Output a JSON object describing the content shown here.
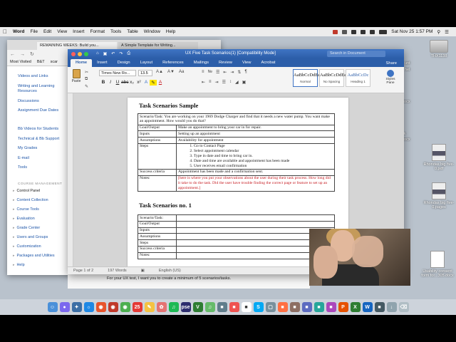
{
  "menubar": {
    "app": "Word",
    "items": [
      "File",
      "Edit",
      "View",
      "Insert",
      "Format",
      "Tools",
      "Table",
      "Window",
      "Help"
    ],
    "clock": "Sat Nov 25  1:57 PM"
  },
  "desktop": {
    "items": [
      {
        "label": "THX1138",
        "kind": "drive"
      },
      {
        "label": "Rhondas big five-0.pdf",
        "kind": "pdf"
      },
      {
        "label": "Rhondas big five-0.pages",
        "kind": "pdf"
      },
      {
        "label": "Usability consent form for...305.docx",
        "kind": "doc"
      }
    ],
    "partials": [
      "unt",
      "hel",
      "docx",
      "sk",
      "docx"
    ]
  },
  "browser": {
    "tabs": [
      "REMAINING WEEKS: Build you...",
      "A Simple Template for Writing..."
    ],
    "bookmarks": [
      "Most Visited",
      "B&T",
      "scar"
    ],
    "nav_links": [
      "Videos and Links",
      "Writing and Learning Resources",
      "Discussions",
      "Assignment Due Dates",
      "Bb Videos for Students",
      "Technical & Bb Support",
      "My Grades",
      "E-mail",
      "Tools"
    ],
    "course_management_heading": "COURSE MANAGEMENT",
    "course_management": [
      "Control Panel",
      "Content Collection",
      "Course Tools",
      "Evaluation",
      "Grade Center",
      "Users and Groups",
      "Customization",
      "Packages and Utilities",
      "Help"
    ]
  },
  "word": {
    "title": "UX Five Task Scenarios(1) [Compatibility Mode]",
    "search_placeholder": "Search in Document",
    "tabs": [
      "Home",
      "Insert",
      "Design",
      "Layout",
      "References",
      "Mailings",
      "Review",
      "View",
      "Acrobat"
    ],
    "share": "Share",
    "font": "Times New Ro...",
    "size": "13.5",
    "paste": "Paste",
    "styles": [
      {
        "sample": "AaBbCcDdEe",
        "name": "Normal"
      },
      {
        "sample": "AaBbCcDdEe",
        "name": "No Spacing"
      },
      {
        "sample": "AaBbCcDc",
        "name": "Heading 1"
      }
    ],
    "styles_pane": "Styles Pane",
    "status": {
      "page": "Page 1 of 2",
      "words": "197 Words",
      "lang": "English (US)",
      "focus": "Fo"
    }
  },
  "document": {
    "heading1": "Task Scenarios Sample",
    "sample_table": {
      "scenario": "Scenario/Task: You are working on your 1969 Dodge Charger and find that it needs a new water pump. You want make an appointment. How would you do that?",
      "rows": [
        {
          "label": "Goal/Output",
          "value": "Make an appointment to bring your car in for repair."
        },
        {
          "label": "Inputs",
          "value": "Setting up an appointment"
        },
        {
          "label": "Assumptions",
          "value": "Availability for appointment"
        }
      ],
      "steps_label": "Steps",
      "steps": [
        "Go to Contact Page",
        "Select appointment calendar",
        "Type in date and time to bring car in.",
        "Date and time are available and appointment has been made",
        "User receives email confirmation"
      ],
      "success_label": "Success criteria",
      "success_value": "Appointment has been made and a confirmation sent.",
      "notes_label": "Notes:",
      "notes_value": "[here is where you put your observations about the user during their task process. How long did it take to do the task. Did the user have trouble finding the correct page or feature to set up an appointment.]"
    },
    "heading2": "Task Scenarios no. 1",
    "blank_table": [
      "Scenario/Task:",
      "Goal/Output",
      "Inputs",
      "Assumptions",
      "Steps",
      "Success criteria",
      "Notes:"
    ]
  },
  "below_text": "For your UX test, I want you to create a minimum of 5 scenarios/tasks."
}
